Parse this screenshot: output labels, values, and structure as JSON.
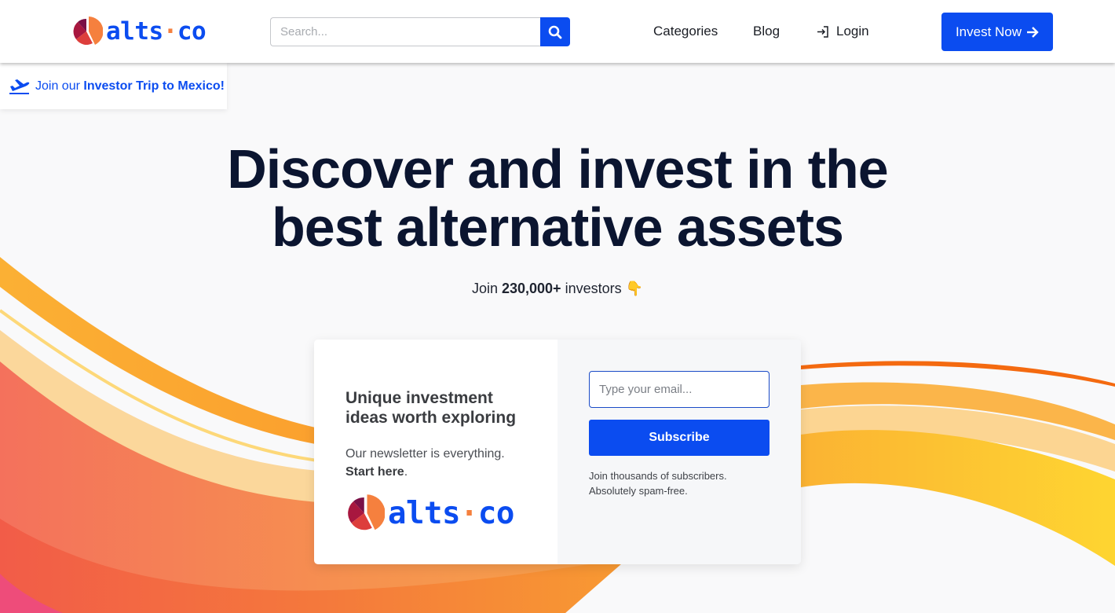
{
  "brand": {
    "name_part1": "alts",
    "name_dot": "·",
    "name_part2": "co",
    "colors": {
      "primary": "#0b4cf0",
      "accent_orange": "#f5803e",
      "heading": "#0b1530"
    }
  },
  "header": {
    "search": {
      "placeholder": "Search...",
      "value": "",
      "icon": "search-icon"
    },
    "nav": [
      {
        "label": "Categories"
      },
      {
        "label": "Blog"
      },
      {
        "label": "Login",
        "icon": "login-icon"
      }
    ],
    "cta": {
      "label": "Invest Now",
      "icon": "arrow-right-icon"
    }
  },
  "promo": {
    "icon": "airplane-takeoff-icon",
    "prefix": "Join our",
    "highlight": "Investor Trip to Mexico!"
  },
  "hero": {
    "title_line1": "Discover and invest in the",
    "title_line2": "best alternative assets",
    "sub_prefix": "Join",
    "sub_count": "230,000+",
    "sub_suffix": "investors",
    "sub_emoji": "👇"
  },
  "newsletter": {
    "title_line1": "Unique investment",
    "title_line2": "ideas worth exploring",
    "desc": "Our newsletter is everything.",
    "start_here": "Start here",
    "start_period": ".",
    "email_placeholder": "Type your email...",
    "email_value": "",
    "subscribe_label": "Subscribe",
    "note_line1": "Join thousands of subscribers.",
    "note_line2": "Absolutely spam-free."
  }
}
